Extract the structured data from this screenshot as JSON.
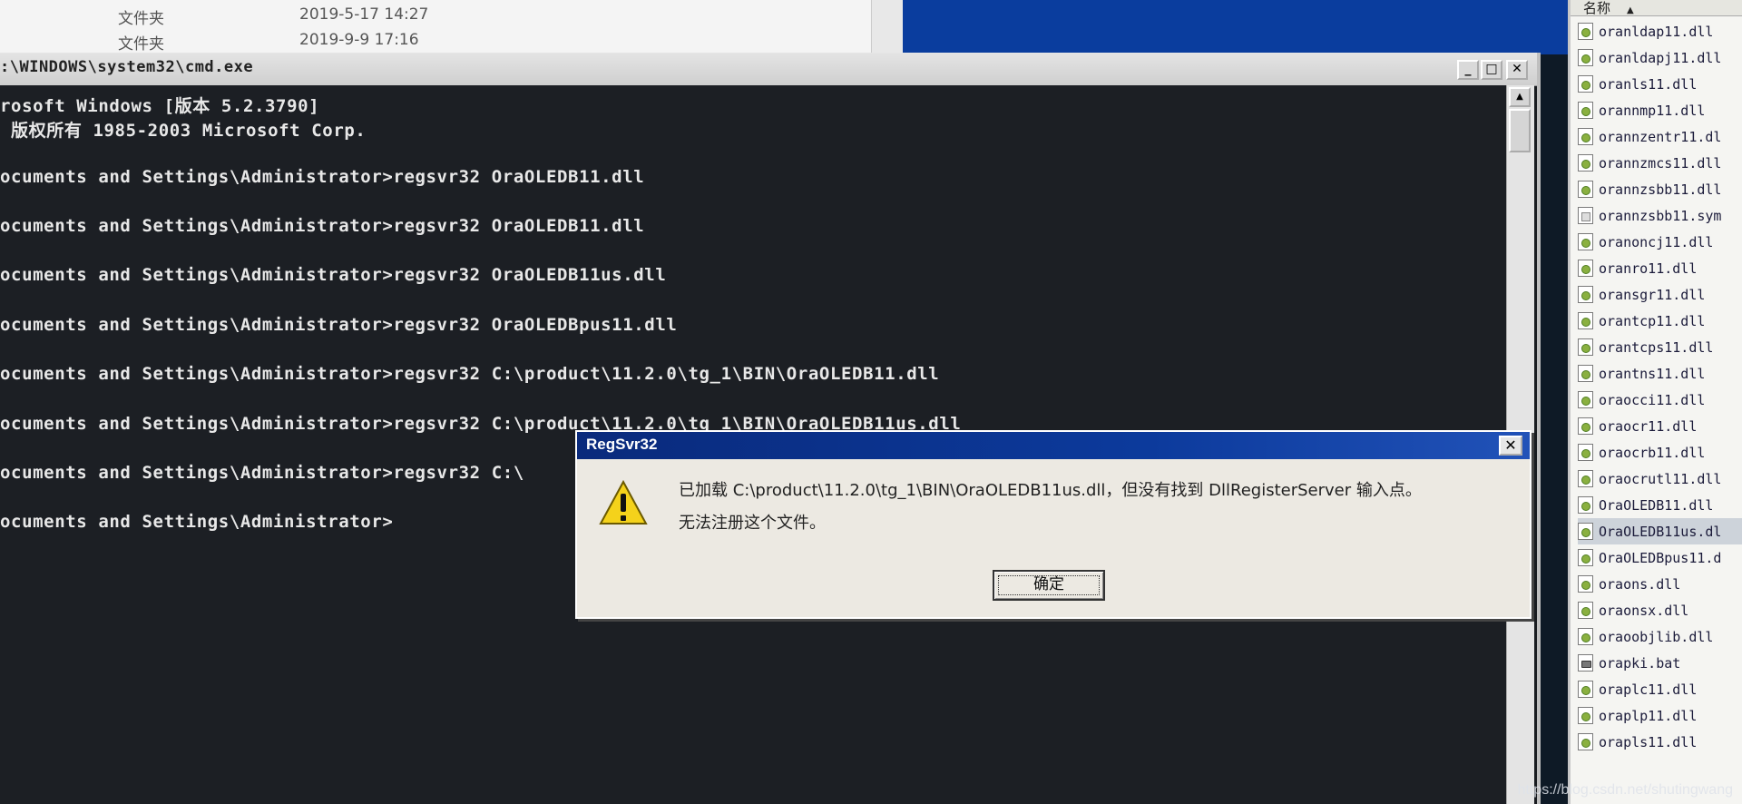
{
  "bg_explorer": {
    "rows": [
      {
        "type": "文件夹",
        "date": "2019-5-17 14:27"
      },
      {
        "type": "文件夹",
        "date": "2019-9-9 17:16"
      }
    ]
  },
  "explorer": {
    "column_header": "名称",
    "sort_indicator": "▲",
    "files": [
      {
        "name": "oranldap11.dll",
        "icon": "dll-file-icon"
      },
      {
        "name": "oranldapj11.dll",
        "icon": "dll-file-icon"
      },
      {
        "name": "oranls11.dll",
        "icon": "dll-file-icon"
      },
      {
        "name": "orannmp11.dll",
        "icon": "dll-file-icon"
      },
      {
        "name": "orannzentr11.dl",
        "icon": "dll-file-icon"
      },
      {
        "name": "orannzmcs11.dll",
        "icon": "dll-file-icon"
      },
      {
        "name": "orannzsbb11.dll",
        "icon": "dll-file-icon"
      },
      {
        "name": "orannzsbb11.sym",
        "icon": "sym-file-icon"
      },
      {
        "name": "oranoncj11.dll",
        "icon": "dll-file-icon"
      },
      {
        "name": "oranro11.dll",
        "icon": "dll-file-icon"
      },
      {
        "name": "oransgr11.dll",
        "icon": "dll-file-icon"
      },
      {
        "name": "orantcp11.dll",
        "icon": "dll-file-icon"
      },
      {
        "name": "orantcps11.dll",
        "icon": "dll-file-icon"
      },
      {
        "name": "orantns11.dll",
        "icon": "dll-file-icon"
      },
      {
        "name": "oraocci11.dll",
        "icon": "dll-file-icon"
      },
      {
        "name": "oraocr11.dll",
        "icon": "dll-file-icon"
      },
      {
        "name": "oraocrb11.dll",
        "icon": "dll-file-icon"
      },
      {
        "name": "oraocrutl11.dll",
        "icon": "dll-file-icon"
      },
      {
        "name": "OraOLEDB11.dll",
        "icon": "dll-file-icon"
      },
      {
        "name": "OraOLEDB11us.dl",
        "icon": "dll-file-icon",
        "selected": true
      },
      {
        "name": "OraOLEDBpus11.d",
        "icon": "dll-file-icon"
      },
      {
        "name": "oraons.dll",
        "icon": "dll-file-icon"
      },
      {
        "name": "oraonsx.dll",
        "icon": "dll-file-icon"
      },
      {
        "name": "oraoobjlib.dll",
        "icon": "dll-file-icon"
      },
      {
        "name": "orapki.bat",
        "icon": "bat-file-icon"
      },
      {
        "name": "oraplc11.dll",
        "icon": "dll-file-icon"
      },
      {
        "name": "oraplp11.dll",
        "icon": "dll-file-icon"
      },
      {
        "name": "orapls11.dll",
        "icon": "dll-file-icon"
      }
    ]
  },
  "cmd": {
    "title": ":\\WINDOWS\\system32\\cmd.exe",
    "lines": [
      "rosoft Windows [版本 5.2.3790]",
      " 版权所有 1985-2003 Microsoft Corp.",
      "",
      "ocuments and Settings\\Administrator>regsvr32 OraOLEDB11.dll",
      "",
      "ocuments and Settings\\Administrator>regsvr32 OraOLEDB11.dll",
      "",
      "ocuments and Settings\\Administrator>regsvr32 OraOLEDB11us.dll",
      "",
      "ocuments and Settings\\Administrator>regsvr32 OraOLEDBpus11.dll",
      "",
      "ocuments and Settings\\Administrator>regsvr32 C:\\product\\11.2.0\\tg_1\\BIN\\OraOLEDB11.dll",
      "",
      "ocuments and Settings\\Administrator>regsvr32 C:\\product\\11.2.0\\tg_1\\BIN\\OraOLEDB11us.dll",
      "",
      "ocuments and Settings\\Administrator>regsvr32 C:\\",
      "",
      "ocuments and Settings\\Administrator>"
    ],
    "minimize_glyph": "_",
    "maximize_glyph": "□",
    "close_glyph": "✕"
  },
  "dialog": {
    "title": "RegSvr32",
    "close_glyph": "✕",
    "message_line1": "已加载 C:\\product\\11.2.0\\tg_1\\BIN\\OraOLEDB11us.dll，但没有找到 DllRegisterServer 输入点。",
    "message_line2": "无法注册这个文件。",
    "ok_label": "确定",
    "icon": "warning-icon"
  },
  "watermark": "https://blog.csdn.net/shutingwang",
  "colors": {
    "dialog_title": "#0c3a9c",
    "console_bg": "#1c1f24",
    "console_text": "#e8e8e8",
    "desktop": "#0a3d9e"
  }
}
